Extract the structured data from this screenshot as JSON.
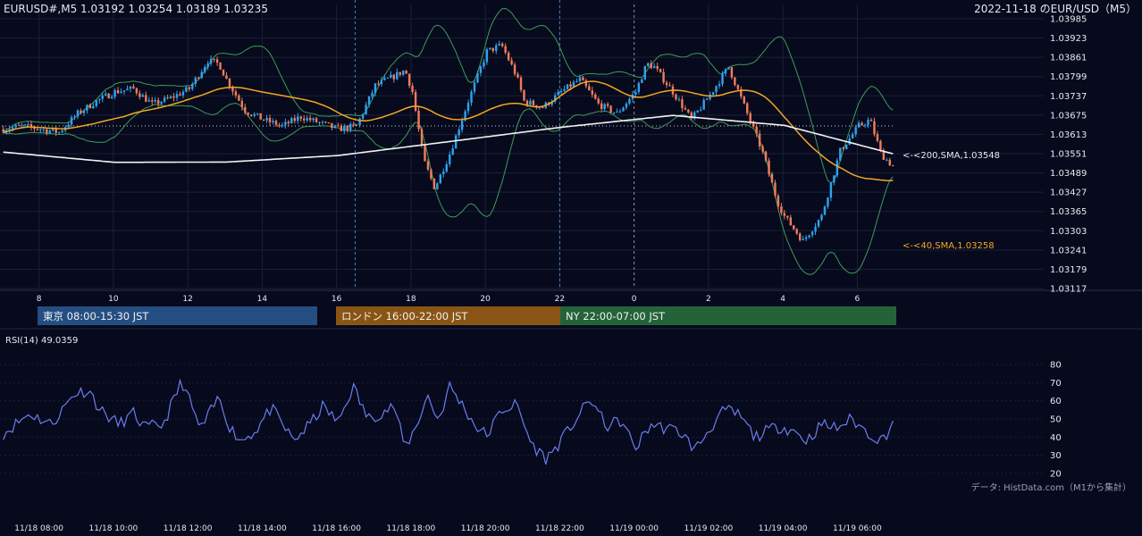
{
  "header": {
    "symbol_ohlc": "EURUSD#,M5 1.03192 1.03254 1.03189 1.03235",
    "title": "2022-11-18 のEUR/USD（M5）"
  },
  "colors": {
    "background": "#070a1c",
    "grid": "#1a2038",
    "candle_up": "#2ea1f0",
    "candle_down": "#f07b5c",
    "sma40": "#f5a623",
    "sma200": "#f2f2f2",
    "bollinger": "#3f9a5a",
    "rsi": "#6b7df0",
    "session_tokyo": "#244e82",
    "session_london": "#8a5514",
    "session_ny": "#24633a"
  },
  "sessions": [
    {
      "label": "東京 08:00-15:30 JST",
      "color": "#244e82"
    },
    {
      "label": "ロンドン 16:00-22:00 JST",
      "color": "#8a5514"
    },
    {
      "label": "NY 22:00-07:00 JST",
      "color": "#24633a"
    }
  ],
  "rsi_panel": {
    "label": "RSI(14) 49.0359",
    "credit": "データ: HistData.com（M1から集計）"
  },
  "chart_data": [
    {
      "type": "candlestick",
      "title": "2022-11-18 のEUR/USD（M5）",
      "y_ticks": [
        "1.03985",
        "1.03923",
        "1.03861",
        "1.03799",
        "1.03737",
        "1.03675",
        "1.03613",
        "1.03551",
        "1.03489",
        "1.03427",
        "1.03365",
        "1.03303",
        "1.03241",
        "1.03179",
        "1.03117"
      ],
      "ylim": [
        1.03117,
        1.03985
      ],
      "x_ticks_hour": [
        "8",
        "10",
        "12",
        "14",
        "16",
        "18",
        "20",
        "22",
        "0",
        "2",
        "4",
        "6"
      ],
      "x_ticks_datetime": [
        "11/18 08:00",
        "11/18 10:00",
        "11/18 12:00",
        "11/18 14:00",
        "11/18 16:00",
        "11/18 18:00",
        "11/18 20:00",
        "11/18 22:00",
        "11/19 00:00",
        "11/19 02:00",
        "11/19 04:00",
        "11/19 06:00"
      ],
      "time_range": [
        "11/18 07:00",
        "11/19 06:55"
      ],
      "bar_interval_minutes": 5,
      "close_path": {
        "t_hours_from_0700": [
          0,
          0.5,
          1,
          1.5,
          2,
          2.5,
          3,
          3.5,
          4,
          4.5,
          5,
          5.5,
          5.8,
          6,
          6.5,
          7,
          7.5,
          8,
          8.5,
          9,
          9.5,
          10,
          10.5,
          10.8,
          11,
          11.3,
          11.6,
          12,
          12.5,
          13,
          13.4,
          13.8,
          14,
          14.5,
          15,
          15.5,
          16,
          16.5,
          17,
          17.3,
          17.5,
          18,
          18.5,
          19,
          19.5,
          20,
          20.4,
          20.8,
          21,
          21.5,
          22,
          22.5,
          23,
          23.3,
          23.6,
          24
        ],
        "close": [
          1.0363,
          1.0364,
          1.0363,
          1.0362,
          1.0368,
          1.0372,
          1.0375,
          1.0376,
          1.0371,
          1.0373,
          1.0376,
          1.0385,
          1.0384,
          1.0379,
          1.0369,
          1.0366,
          1.0364,
          1.0367,
          1.0365,
          1.0363,
          1.0364,
          1.0377,
          1.038,
          1.0382,
          1.0375,
          1.0353,
          1.0344,
          1.0355,
          1.0372,
          1.0388,
          1.039,
          1.038,
          1.0372,
          1.037,
          1.0375,
          1.0379,
          1.0371,
          1.0368,
          1.0375,
          1.0384,
          1.0383,
          1.0375,
          1.0366,
          1.0374,
          1.0383,
          1.0368,
          1.0356,
          1.034,
          1.0335,
          1.0327,
          1.0335,
          1.0356,
          1.0364,
          1.0366,
          1.0355,
          1.035
        ]
      },
      "indicators": [
        {
          "name": "<-<200,SMA,1.03548",
          "value": 1.03548
        },
        {
          "name": "<-<40,SMA,1.03258",
          "value": 1.03258
        }
      ],
      "reference_line": 1.0364,
      "session_times_jst": {
        "tokyo": [
          "08:00",
          "15:30"
        ],
        "london": [
          "16:00",
          "22:00"
        ],
        "ny": [
          "22:00",
          "07:00"
        ]
      }
    },
    {
      "type": "line",
      "title": "RSI(14) 49.0359",
      "y_ticks": [
        "80",
        "70",
        "60",
        "50",
        "40",
        "30",
        "20"
      ],
      "ylim": [
        20,
        80
      ],
      "last_value": 49.0359,
      "key_points": {
        "t_hours_from_0700": [
          0,
          0.7,
          1.3,
          1.9,
          2.3,
          2.6,
          3.1,
          3.5,
          3.8,
          4.3,
          4.8,
          5.3,
          5.8,
          6.1,
          6.4,
          6.8,
          7.2,
          7.8,
          8.2,
          8.6,
          9,
          9.4,
          9.8,
          10.2,
          10.5,
          10.8,
          11.1,
          11.4,
          11.7,
          12,
          12.3,
          12.7,
          13,
          13.4,
          13.8,
          14.2,
          14.6,
          15,
          15.4,
          15.8,
          16.2,
          16.6,
          17,
          17.4,
          17.8,
          18.2,
          18.6,
          19,
          19.4,
          19.8,
          20.2,
          20.6,
          20.9,
          21.3,
          21.6,
          22,
          22.4,
          22.8,
          23.2,
          23.6,
          24
        ],
        "rsi": [
          42,
          53,
          47,
          64,
          66,
          55,
          47,
          53,
          45,
          47,
          71,
          44,
          62,
          45,
          38,
          44,
          56,
          38,
          46,
          57,
          48,
          68,
          50,
          54,
          57,
          34,
          46,
          63,
          49,
          68,
          59,
          46,
          41,
          55,
          58,
          36,
          28,
          38,
          50,
          61,
          46,
          49,
          34,
          47,
          45,
          43,
          33,
          45,
          55,
          52,
          40,
          44,
          46,
          43,
          38,
          47,
          45,
          50,
          43,
          38,
          49
        ]
      }
    }
  ]
}
